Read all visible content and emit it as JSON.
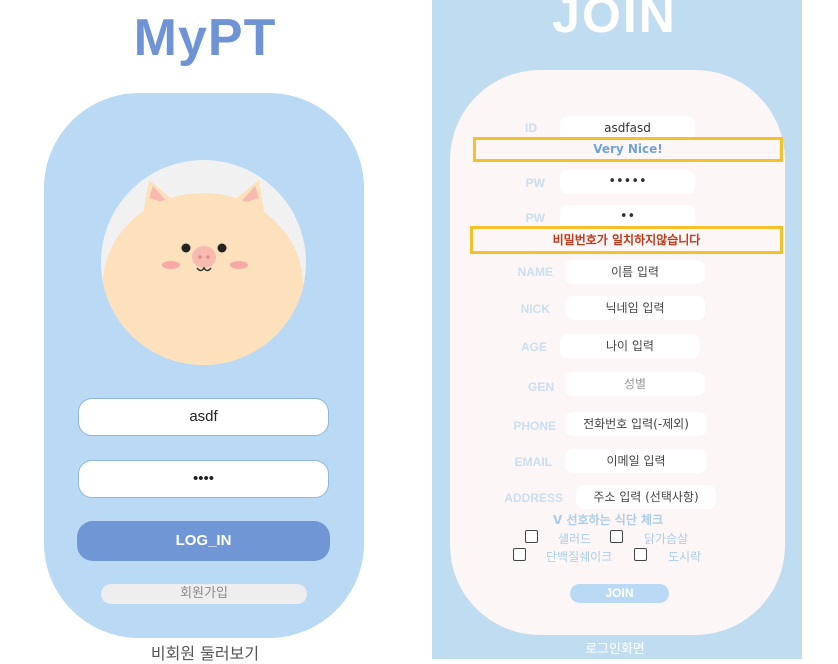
{
  "login": {
    "app_title": "MyPT",
    "id_value": "asdf",
    "pw_value": "••••",
    "login_button": "LOG_IN",
    "signup_button": "회원가입",
    "guest_link": "비회원 둘러보기"
  },
  "join": {
    "title": "JOIN",
    "fields": {
      "id": {
        "label": "ID",
        "value": "asdfasd"
      },
      "id_message": "Very Nice!",
      "pw": {
        "label": "PW",
        "value": "•••••"
      },
      "pw_confirm": {
        "label": "PW",
        "value": "••"
      },
      "pw_message": "비밀번호가 일치하지않습니다",
      "name": {
        "label": "NAME",
        "placeholder": "이름 입력"
      },
      "nick": {
        "label": "NICK",
        "placeholder": "닉네임 입력"
      },
      "age": {
        "label": "AGE",
        "placeholder": "나이 입력"
      },
      "gen": {
        "label": "GEN",
        "placeholder": "성별"
      },
      "phone": {
        "label": "PHONE",
        "placeholder": "전화번호 입력(-제외)"
      },
      "email": {
        "label": "EMAIL",
        "placeholder": "이메일 입력"
      },
      "address": {
        "label": "ADDRESS",
        "placeholder": "주소 입력 (선택사항)"
      }
    },
    "preference_title": "V 선호하는 식단 체크",
    "preferences": [
      "샐러드",
      "닭가슴살",
      "단백질쉐이크",
      "도시락"
    ],
    "join_button": "JOIN",
    "back_link": "로그인화면"
  },
  "colors": {
    "brand_blue": "#6f94d6",
    "card_blue": "#b9d9f4",
    "success_text": "#6fa3d8",
    "error_text": "#c0391b",
    "highlight_border": "#f5c12b"
  }
}
